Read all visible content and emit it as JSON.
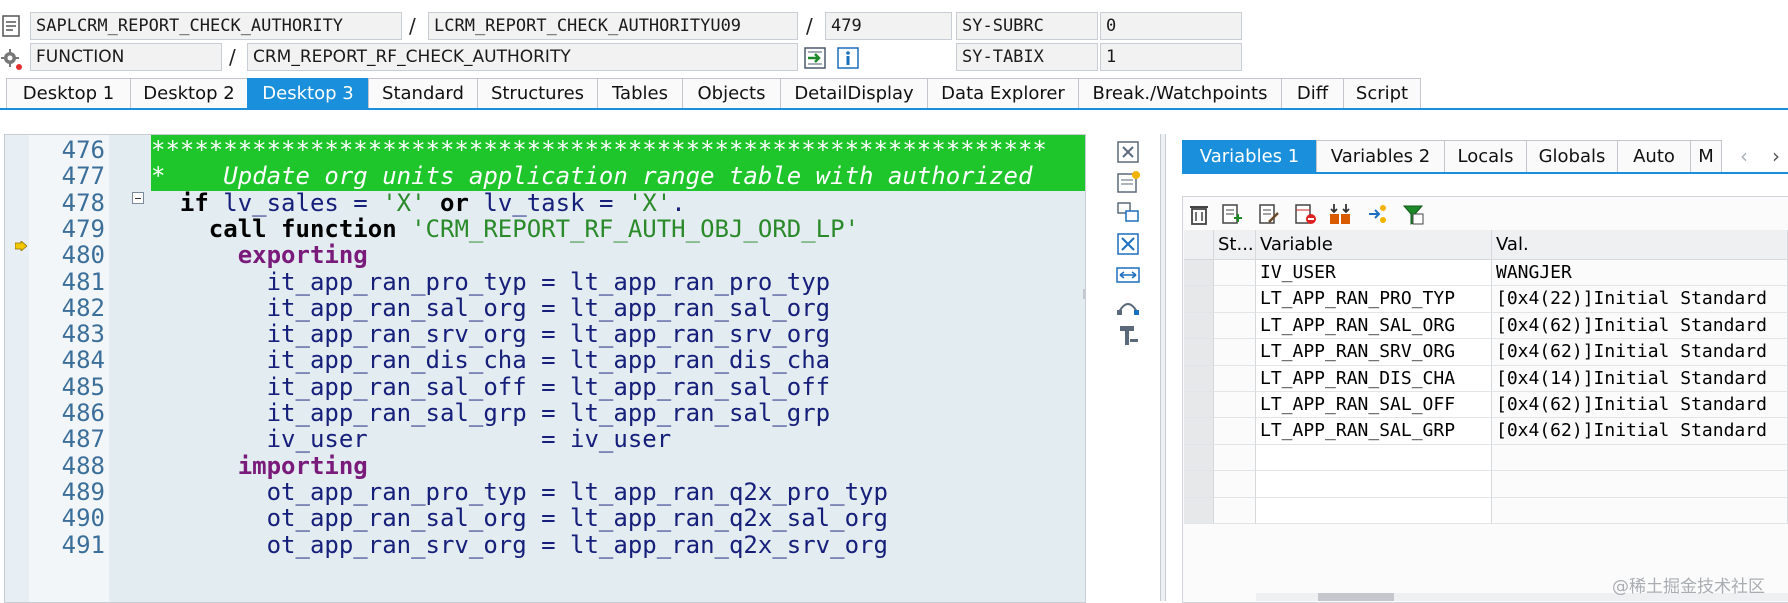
{
  "header": {
    "program": "SAPLCRM_REPORT_CHECK_AUTHORITY",
    "include": "LCRM_REPORT_CHECK_AUTHORITYU09",
    "line": "479",
    "type": "FUNCTION",
    "name": "CRM_REPORT_RF_CHECK_AUTHORITY",
    "sy_subrc_label": "SY-SUBRC",
    "sy_subrc_value": "0",
    "sy_tabix_label": "SY-TABIX",
    "sy_tabix_value": "1",
    "separator": "/"
  },
  "tabs": [
    {
      "label": "Desktop 1"
    },
    {
      "label": "Desktop 2"
    },
    {
      "label": "Desktop 3"
    },
    {
      "label": "Standard"
    },
    {
      "label": "Structures"
    },
    {
      "label": "Tables"
    },
    {
      "label": "Objects"
    },
    {
      "label": "DetailDisplay"
    },
    {
      "label": "Data Explorer"
    },
    {
      "label": "Break./Watchpoints"
    },
    {
      "label": "Diff"
    },
    {
      "label": "Script"
    }
  ],
  "active_tab": "Desktop 3",
  "editor": {
    "lines": [
      {
        "n": "476",
        "t": "**************************************************************"
      },
      {
        "n": "477",
        "t": "*    Update org units application range table with authorized"
      },
      {
        "n": "478",
        "a": "  ",
        "k": "if",
        "b": " lv_sales = ",
        "s": "'X'",
        "c": " ",
        "k2": "or",
        "d": " lv_task = ",
        "s2": "'X'",
        "e": "."
      },
      {
        "n": "479",
        "a": "    ",
        "k": "call function",
        "b": " ",
        "s": "'CRM_REPORT_RF_AUTH_OBJ_ORD_LP'"
      },
      {
        "n": "480",
        "a": "      ",
        "p": "exporting"
      },
      {
        "n": "481",
        "t": "        it_app_ran_pro_typ = lt_app_ran_pro_typ"
      },
      {
        "n": "482",
        "t": "        it_app_ran_sal_org = lt_app_ran_sal_org"
      },
      {
        "n": "483",
        "t": "        it_app_ran_srv_org = lt_app_ran_srv_org"
      },
      {
        "n": "484",
        "t": "        it_app_ran_dis_cha = lt_app_ran_dis_cha"
      },
      {
        "n": "485",
        "t": "        it_app_ran_sal_off = lt_app_ran_sal_off"
      },
      {
        "n": "486",
        "t": "        it_app_ran_sal_grp = lt_app_ran_sal_grp"
      },
      {
        "n": "487",
        "t": "        iv_user            = iv_user"
      },
      {
        "n": "488",
        "a": "      ",
        "p": "importing"
      },
      {
        "n": "489",
        "t": "        ot_app_ran_pro_typ = lt_app_ran_q2x_pro_typ"
      },
      {
        "n": "490",
        "t": "        ot_app_ran_sal_org = lt_app_ran_q2x_sal_org"
      },
      {
        "n": "491",
        "t": "        ot_app_ran_srv_org = lt_app_ran_q2x_srv_org"
      }
    ]
  },
  "right_tabs": [
    {
      "label": "Variables 1"
    },
    {
      "label": "Variables 2"
    },
    {
      "label": "Locals"
    },
    {
      "label": "Globals"
    },
    {
      "label": "Auto"
    },
    {
      "label": "M"
    }
  ],
  "right_active_tab": "Variables 1",
  "grid": {
    "headers": {
      "status": "St...",
      "variable": "Variable",
      "value": "Val."
    },
    "rows": [
      {
        "variable": "IV_USER",
        "value": "WANGJER"
      },
      {
        "variable": "LT_APP_RAN_PRO_TYP",
        "value": "[0x4(22)]Initial Standard"
      },
      {
        "variable": "LT_APP_RAN_SAL_ORG",
        "value": "[0x4(62)]Initial Standard"
      },
      {
        "variable": "LT_APP_RAN_SRV_ORG",
        "value": "[0x4(62)]Initial Standard"
      },
      {
        "variable": "LT_APP_RAN_DIS_CHA",
        "value": "[0x4(14)]Initial Standard"
      },
      {
        "variable": "LT_APP_RAN_SAL_OFF",
        "value": "[0x4(62)]Initial Standard"
      },
      {
        "variable": "LT_APP_RAN_SAL_GRP",
        "value": "[0x4(62)]Initial Standard"
      }
    ]
  },
  "watermark": "@稀土掘金技术社区",
  "colors": {
    "accent": "#1a8fdb",
    "highlight": "#1ec52b",
    "editor_bg": "#e3ecf1"
  }
}
